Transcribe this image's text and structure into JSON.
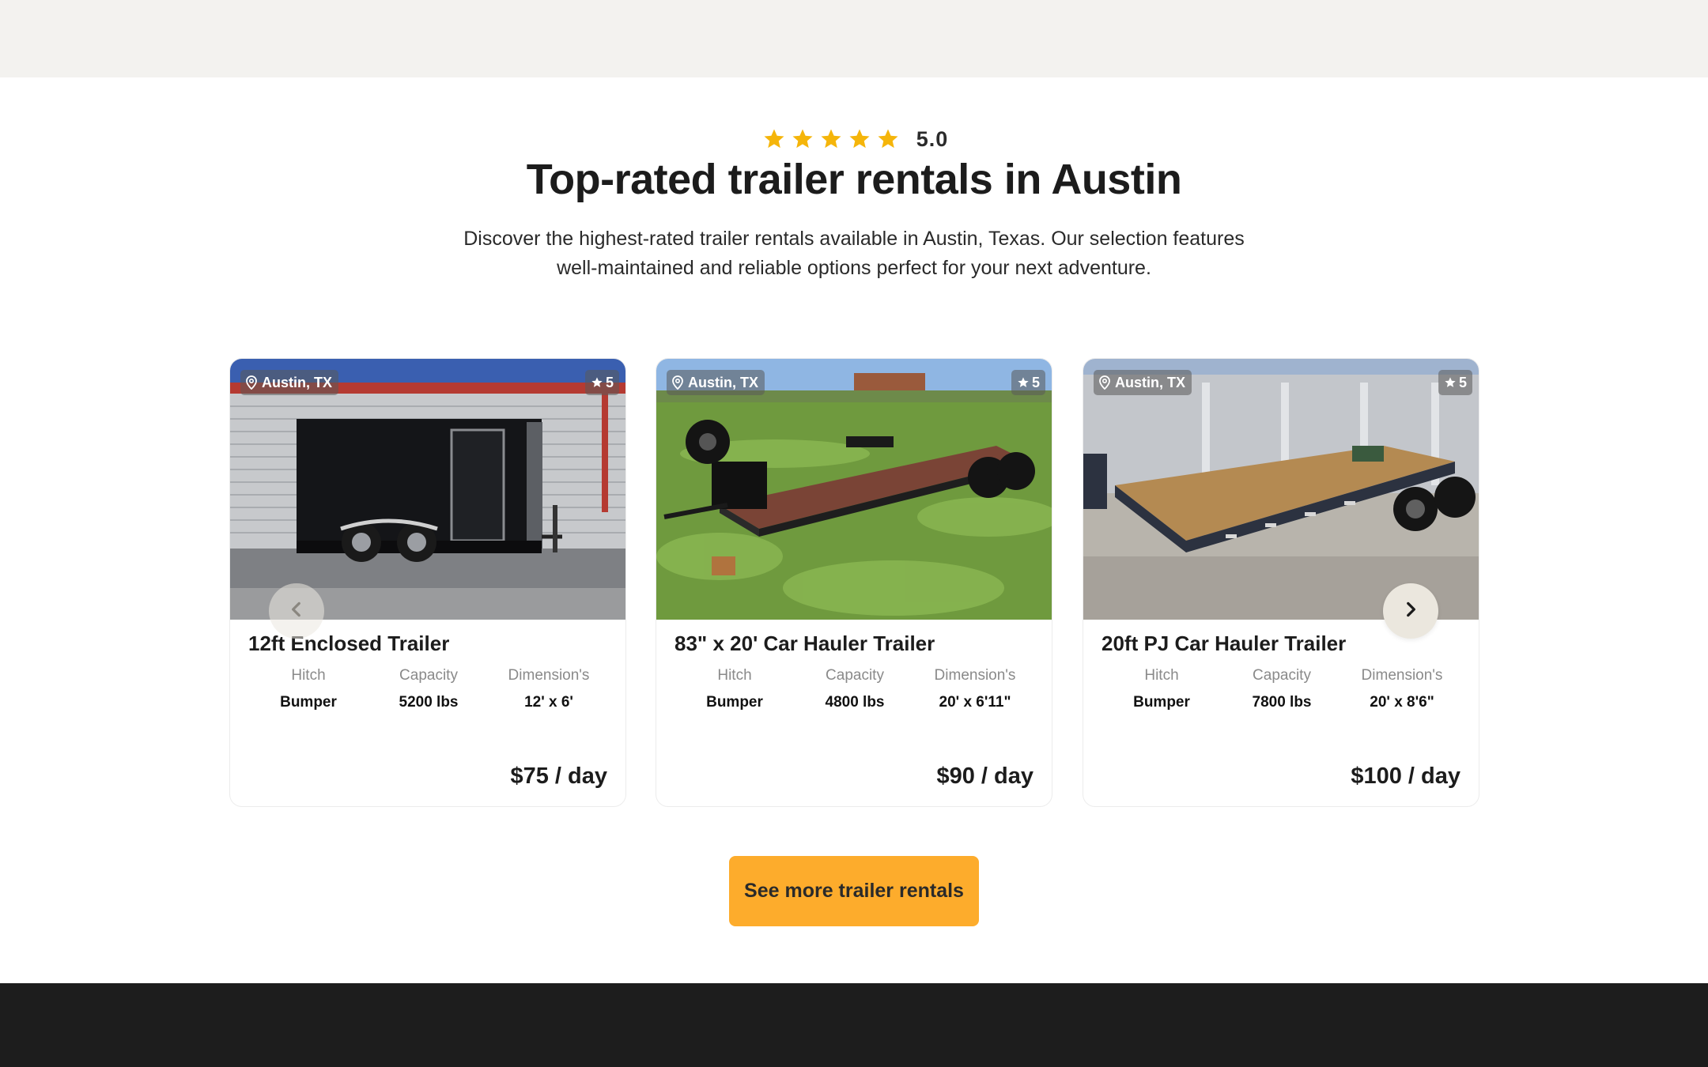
{
  "section": {
    "rating_value": "5.0",
    "rating_stars": 5,
    "star_color": "#f5b50a",
    "headline": "Top-rated trailer rentals in Austin",
    "description": "Discover the highest-rated trailer rentals available in Austin, Texas. Our selection features well-maintained and reliable options perfect for your next adventure."
  },
  "labels": {
    "hitch": "Hitch",
    "capacity": "Capacity",
    "dimensions": "Dimension's"
  },
  "cards": [
    {
      "location": "Austin, TX",
      "rating": "5",
      "title": "12ft Enclosed Trailer",
      "hitch": "Bumper",
      "capacity": "5200 lbs",
      "dimensions": "12' x 6'",
      "price": "$75 / day",
      "image_icon": "enclosed-trailer-photo"
    },
    {
      "location": "Austin, TX",
      "rating": "5",
      "title": "83\" x 20' Car Hauler Trailer",
      "hitch": "Bumper",
      "capacity": "4800 lbs",
      "dimensions": "20' x 6'11\"",
      "price": "$90 / day",
      "image_icon": "car-hauler-trailer-photo"
    },
    {
      "location": "Austin, TX",
      "rating": "5",
      "title": "20ft PJ Car Hauler Trailer",
      "hitch": "Bumper",
      "capacity": "7800 lbs",
      "dimensions": "20' x 8'6\"",
      "price": "$100 / day",
      "image_icon": "pj-car-hauler-trailer-photo"
    }
  ],
  "cta": {
    "label": "See more trailer rentals",
    "color": "#fdac2c"
  },
  "colors": {
    "top_band": "#f3f2ef",
    "footer": "#1d1d1d"
  }
}
